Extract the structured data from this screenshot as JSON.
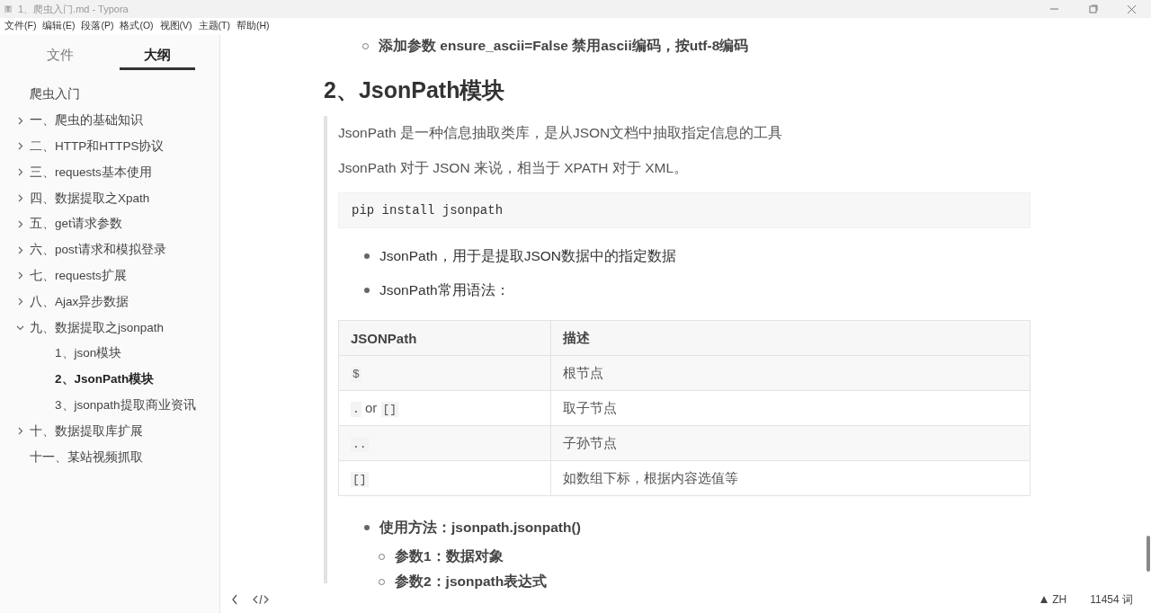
{
  "window": {
    "title": "1、爬虫入门.md - Typora"
  },
  "menu": [
    "文件(F)",
    "编辑(E)",
    "段落(P)",
    "格式(O)",
    "视图(V)",
    "主题(T)",
    "帮助(H)"
  ],
  "sidebar": {
    "tabs": [
      {
        "label": "文件",
        "selected": false
      },
      {
        "label": "大纲",
        "selected": true
      }
    ],
    "outline": [
      {
        "label": "爬虫入门",
        "selected": false
      },
      {
        "label": "一、爬虫的基础知识",
        "expanded": false,
        "selected": false
      },
      {
        "label": "二、HTTP和HTTPS协议",
        "expanded": false,
        "selected": false
      },
      {
        "label": "三、requests基本使用",
        "expanded": false,
        "selected": false
      },
      {
        "label": "四、数据提取之Xpath",
        "expanded": false,
        "selected": false
      },
      {
        "label": "五、get请求参数",
        "expanded": false,
        "selected": false
      },
      {
        "label": "六、post请求和模拟登录",
        "expanded": false,
        "selected": false
      },
      {
        "label": "七、requests扩展",
        "expanded": false,
        "selected": false
      },
      {
        "label": "八、Ajax异步数据",
        "expanded": false,
        "selected": false
      },
      {
        "label": "九、数据提取之jsonpath",
        "expanded": true,
        "selected": false,
        "children": [
          {
            "label": "1、json模块",
            "selected": false
          },
          {
            "label": "2、JsonPath模块",
            "selected": true
          },
          {
            "label": "3、jsonpath提取商业资讯",
            "selected": false
          }
        ]
      },
      {
        "label": "十、数据提取库扩展",
        "expanded": false,
        "selected": false
      },
      {
        "label": "十一、某站视频抓取",
        "selected": false
      }
    ]
  },
  "document": [
    {
      "kind": "sub_bullet",
      "text": "添加参数 ensure_ascii=False 禁用ascii编码，按utf-8编码",
      "bold": true
    },
    {
      "kind": "heading",
      "text": "2、JsonPath模块"
    },
    {
      "kind": "quote",
      "blocks": [
        {
          "kind": "paragraph",
          "text": "JsonPath 是一种信息抽取类库，是从JSON文档中抽取指定信息的工具"
        },
        {
          "kind": "paragraph",
          "text": "JsonPath 对于 JSON 来说，相当于 XPATH 对于 XML。"
        },
        {
          "kind": "code",
          "text": "pip install jsonpath"
        },
        {
          "kind": "bullet",
          "text": "JsonPath，用于是提取JSON数据中的指定数据",
          "bold": false
        },
        {
          "kind": "bullet",
          "text": "JsonPath常用语法：",
          "bold": false
        },
        {
          "kind": "table",
          "columns": [
            "JSONPath",
            "描述"
          ],
          "rows": [
            [
              [
                {
                  "text": "$",
                  "code": true
                }
              ],
              [
                {
                  "text": "根节点",
                  "code": false
                }
              ]
            ],
            [
              [
                {
                  "text": ".",
                  "code": true
                },
                {
                  "text": " or ",
                  "code": false
                },
                {
                  "text": "[]",
                  "code": true
                }
              ],
              [
                {
                  "text": "取子节点",
                  "code": false
                }
              ]
            ],
            [
              [
                {
                  "text": "..",
                  "code": true
                }
              ],
              [
                {
                  "text": "子孙节点",
                  "code": false
                }
              ]
            ],
            [
              [
                {
                  "text": "[]",
                  "code": true
                }
              ],
              [
                {
                  "text": "如数组下标，根据内容选值等",
                  "code": false
                }
              ]
            ]
          ]
        },
        {
          "kind": "bullet",
          "text": "使用方法：jsonpath.jsonpath()",
          "bold": true
        },
        {
          "kind": "sub_bullet",
          "text": "参数1：数据对象",
          "bold": true
        },
        {
          "kind": "sub_bullet",
          "text": "参数2：jsonpath表达式",
          "bold": true
        }
      ]
    }
  ],
  "status_bar": {
    "language": "ZH",
    "word_count": "11454 词"
  }
}
